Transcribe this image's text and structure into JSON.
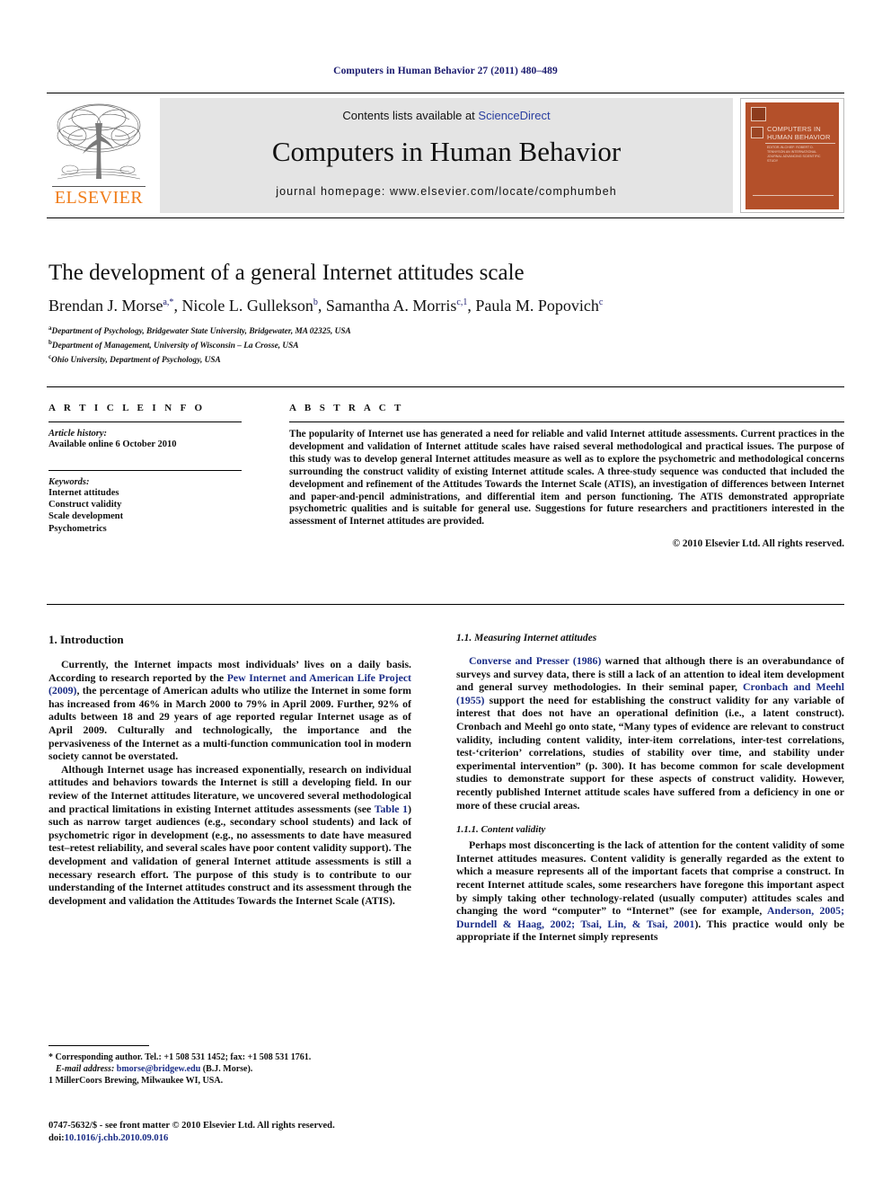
{
  "running_head": "Computers in Human Behavior 27 (2011) 480–489",
  "masthead": {
    "publisher_wordmark": "ELSEVIER",
    "contents_prefix": "Contents lists available at ",
    "contents_link": "ScienceDirect",
    "journal_title": "Computers in Human Behavior",
    "homepage": "journal homepage: www.elsevier.com/locate/comphumbeh",
    "cover": {
      "title": "COMPUTERS IN HUMAN BEHAVIOR",
      "subtitle": "EDITOR-IN-CHIEF: ROBERT D. TENNYSON  AN INTERNATIONAL JOURNAL  ADVANCING SCIENTIFIC STUDY"
    }
  },
  "article": {
    "title": "The development of a general Internet attitudes scale",
    "authors": [
      {
        "name": "Brendan J. Morse",
        "marks": "a,*"
      },
      {
        "name": "Nicole L. Gullekson",
        "marks": "b"
      },
      {
        "name": "Samantha A. Morris",
        "marks": "c,1"
      },
      {
        "name": "Paula M. Popovich",
        "marks": "c"
      }
    ],
    "affiliations": [
      {
        "mark": "a",
        "text": "Department of Psychology, Bridgewater State University, Bridgewater, MA 02325, USA"
      },
      {
        "mark": "b",
        "text": "Department of Management, University of Wisconsin – La Crosse, USA"
      },
      {
        "mark": "c",
        "text": "Ohio University, Department of Psychology, USA"
      }
    ]
  },
  "info": {
    "heading": "A R T I C L E   I N F O",
    "history_label": "Article history:",
    "history_value": "Available online 6 October 2010",
    "keywords_label": "Keywords:",
    "keywords": [
      "Internet attitudes",
      "Construct validity",
      "Scale development",
      "Psychometrics"
    ]
  },
  "abstract": {
    "heading": "A B S T R A C T",
    "text": "The popularity of Internet use has generated a need for reliable and valid Internet attitude assessments. Current practices in the development and validation of Internet attitude scales have raised several methodological and practical issues. The purpose of this study was to develop general Internet attitudes measure as well as to explore the psychometric and methodological concerns surrounding the construct validity of existing Internet attitude scales. A three-study sequence was conducted that included the development and refinement of the Attitudes Towards the Internet Scale (ATIS), an investigation of differences between Internet and paper-and-pencil administrations, and differential item and person functioning. The ATIS demonstrated appropriate psychometric qualities and is suitable for general use. Suggestions for future researchers and practitioners interested in the assessment of Internet attitudes are provided.",
    "copyright": "© 2010 Elsevier Ltd. All rights reserved."
  },
  "body": {
    "section1_heading": "1. Introduction",
    "para1": {
      "p1": "Currently, the Internet impacts most individuals’ lives on a daily basis. According to research reported by the ",
      "cite1": "Pew Internet and American Life Project (2009)",
      "p2": ", the percentage of American adults who utilize the Internet in some form has increased from 46% in March 2000 to 79% in April 2009. Further, 92% of adults between 18 and 29 years of age reported regular Internet usage as of April 2009. Culturally and technologically, the importance and the pervasiveness of the Internet as a multi-function communication tool in modern society cannot be overstated."
    },
    "para2": {
      "p1": "Although Internet usage has increased exponentially, research on individual attitudes and behaviors towards the Internet is still a developing field. In our review of the Internet attitudes literature, we uncovered several methodological and practical limitations in existing Internet attitudes assessments (see ",
      "cite1": "Table 1",
      "p2": ") such as narrow target audiences (e.g., secondary school students) and lack of psychometric rigor in development (e.g., no assessments to date have measured test–retest reliability, and several scales have poor content validity support). The development and validation of general Internet attitude assessments is still a necessary research effort. The purpose of this study is to contribute to our understanding of the Internet attitudes construct and its assessment through the development and validation the Attitudes Towards the Internet Scale (ATIS)."
    },
    "subsection11_heading": "1.1. Measuring Internet attitudes",
    "para3": {
      "cite1": "Converse and Presser (1986)",
      "p1": " warned that although there is an overabundance of surveys and survey data, there is still a lack of an attention to ideal item development and general survey methodologies. In their seminal paper, ",
      "cite2": "Cronbach and Meehl (1955)",
      "p2": " support the need for establishing the construct validity for any variable of interest that does not have an operational definition (i.e., a latent construct). Cronbach and Meehl go onto state, “Many types of evidence are relevant to construct validity, including content validity, inter-item correlations, inter-test correlations, test-‘criterion’ correlations, studies of stability over time, and stability under experimental intervention” (p. 300). It has become common for scale development studies to demonstrate support for these aspects of construct validity. However, recently published Internet attitude scales have suffered from a deficiency in one or more of these crucial areas."
    },
    "subsubsection111_heading": "1.1.1. Content validity",
    "para4": {
      "p1": "Perhaps most disconcerting is the lack of attention for the content validity of some Internet attitudes measures. Content validity is generally regarded as the extent to which a measure represents all of the important facets that comprise a construct. In recent Internet attitude scales, some researchers have foregone this important aspect by simply taking other technology-related (usually computer) attitudes scales and changing the word “computer” to “Internet” (see for example, ",
      "cite1": "Anderson, 2005; Durndell & Haag, 2002; Tsai, Lin, & Tsai, 2001",
      "p2": "). This practice would only be appropriate if the Internet simply represents"
    }
  },
  "footnotes": {
    "corresponding": "* Corresponding author. Tel.: +1 508 531 1452; fax: +1 508 531 1761.",
    "email_label": "E-mail address:",
    "email": "bmorse@bridgew.edu",
    "email_suffix": "(B.J. Morse).",
    "note1": "1 MillerCoors Brewing, Milwaukee WI, USA.",
    "issn_line": "0747-5632/$ - see front matter © 2010 Elsevier Ltd. All rights reserved.",
    "doi_label": "doi:",
    "doi": "10.1016/j.chb.2010.09.016"
  }
}
